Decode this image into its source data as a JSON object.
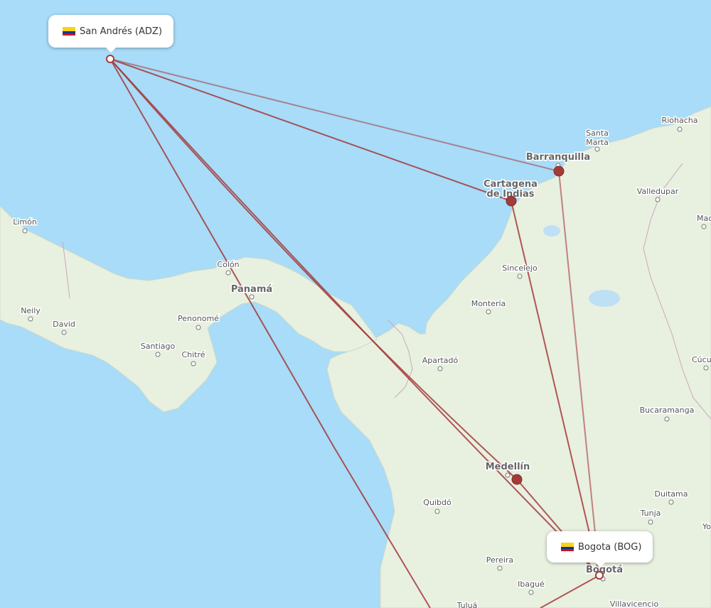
{
  "origin": {
    "label": "San Andrés (ADZ)",
    "flag_colors": [
      "#FCD116",
      "#003893",
      "#CE1126"
    ]
  },
  "destination": {
    "label": "Bogota (BOG)",
    "flag_colors": [
      "#FCD116",
      "#003893",
      "#CE1126"
    ]
  },
  "route_color": "#a33b3b",
  "cities": [
    {
      "name": "Riohacha"
    },
    {
      "name": "Santa"
    },
    {
      "name": "Marta"
    },
    {
      "name": "Barranquilla"
    },
    {
      "name": "Cartagena"
    },
    {
      "name": "de Indias"
    },
    {
      "name": "Valledupar"
    },
    {
      "name": "Machiq"
    },
    {
      "name": "Limón"
    },
    {
      "name": "Colón"
    },
    {
      "name": "Panamá"
    },
    {
      "name": "Sincelejo"
    },
    {
      "name": "Montería"
    },
    {
      "name": "Neily"
    },
    {
      "name": "David"
    },
    {
      "name": "Penonomé"
    },
    {
      "name": "Santiago"
    },
    {
      "name": "Chitré"
    },
    {
      "name": "Apartadó"
    },
    {
      "name": "Cúcu"
    },
    {
      "name": "Bucaramanga"
    },
    {
      "name": "Medellín"
    },
    {
      "name": "Quibdó"
    },
    {
      "name": "Duitama"
    },
    {
      "name": "Tunja"
    },
    {
      "name": "Yo"
    },
    {
      "name": "Pereira"
    },
    {
      "name": "Ibagué"
    },
    {
      "name": "Bogotá"
    },
    {
      "name": "Tuluá"
    },
    {
      "name": "Villavicencio"
    }
  ]
}
